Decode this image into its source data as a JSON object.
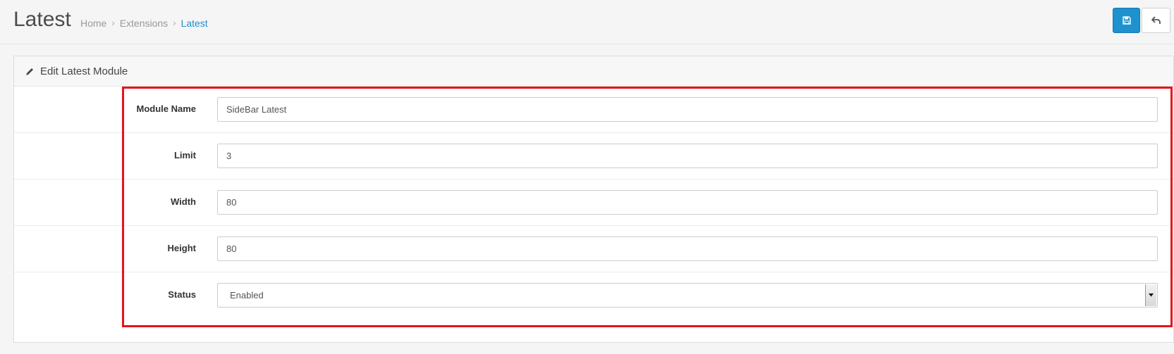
{
  "header": {
    "title": "Latest",
    "breadcrumb": [
      {
        "label": "Home",
        "active": false
      },
      {
        "label": "Extensions",
        "active": false
      },
      {
        "label": "Latest",
        "active": true
      }
    ],
    "save_icon": "floppy-disk-icon",
    "back_icon": "reply-arrow-icon",
    "colors": {
      "primary": "#1e91cf",
      "highlight": "#e8121a"
    }
  },
  "panel": {
    "icon": "pencil-icon",
    "title": "Edit Latest Module"
  },
  "form": {
    "module_name": {
      "label": "Module Name",
      "value": "SideBar Latest"
    },
    "limit": {
      "label": "Limit",
      "value": "3"
    },
    "width": {
      "label": "Width",
      "value": "80"
    },
    "height": {
      "label": "Height",
      "value": "80"
    },
    "status": {
      "label": "Status",
      "value": "Enabled"
    }
  }
}
